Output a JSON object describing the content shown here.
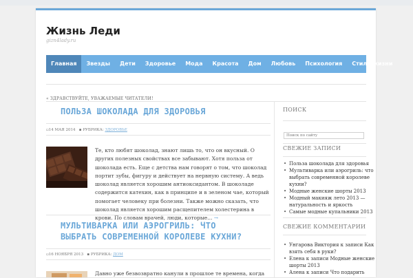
{
  "site": {
    "title": "Жизнь Леди",
    "description": "gizn4lady.ru"
  },
  "nav": {
    "items": [
      {
        "label": "Главная",
        "active": true
      },
      {
        "label": "Звезды"
      },
      {
        "label": "Дети"
      },
      {
        "label": "Здоровье"
      },
      {
        "label": "Мода"
      },
      {
        "label": "Красота"
      },
      {
        "label": "Дом"
      },
      {
        "label": "Любовь"
      },
      {
        "label": "Психология"
      },
      {
        "label": "Стиль жизни"
      }
    ]
  },
  "notice": "« ЗДРАВСТВУЙТЕ, УВАЖАЕМЫЕ ЧИТАТЕЛИ!",
  "posts": [
    {
      "title": "ПОЛЬЗА ШОКОЛАДА ДЛЯ ЗДОРОВЬЯ",
      "date": "14 МАЯ 2014",
      "category_label": "РУБРИКА:",
      "category": "ЗДОРОВЬЕ",
      "excerpt": "Те, кто любят шоколад, знают лишь то, что он вкусный. О других полезных свойствах все забывают. Хотя польза от шоколада есть. Еще с детства нам говорят о том, что шоколад портит зубы, фигуру и действует на нервную систему. А ведь шоколад является хорошим антиоксидантом. В шоколаде содержится катехин, как в принципе и в зеленом чае, который помогает человеку при болезни. Также можно сказать, что шоколад является хорошим расщепителем холестерина в крови. По словам врачей, люди, которые...",
      "more": "→"
    },
    {
      "title_line1": "МУЛЬТИВАРКА ИЛИ АЭРОГРИЛЬ: ЧТО",
      "title_line2": "ВЫБРАТЬ СОВРЕМЕННОЙ КОРОЛЕВЕ КУХНИ?",
      "date": "16 НОЯБРЯ 2013",
      "category_label": "РУБРИКА:",
      "category": "ДОМ",
      "excerpt": "Давно уже безвозвратно канули в прошлое те времена, когда"
    }
  ],
  "sidebar": {
    "search": {
      "heading": "ПОИСК",
      "placeholder": "Поиск по сайту"
    },
    "recent_posts": {
      "heading": "СВЕЖИЕ ЗАПИСИ",
      "items": [
        "Польза шоколада для здоровья",
        "Мультиварка или аэрогриль: что выбрать современной королеве кухни?",
        "Модные женские шорты 2013",
        "Модный макияж лето 2013 — натуральность и яркость",
        "Самые модные купальники 2013"
      ]
    },
    "recent_comments": {
      "heading": "СВЕЖИЕ КОММЕНТАРИИ",
      "items": [
        "Унгарова Виктория к записи Как взять себя в руки?",
        "Елена к записи Модные женские шорты 2013",
        "Алена к записи Что подарить"
      ]
    }
  }
}
